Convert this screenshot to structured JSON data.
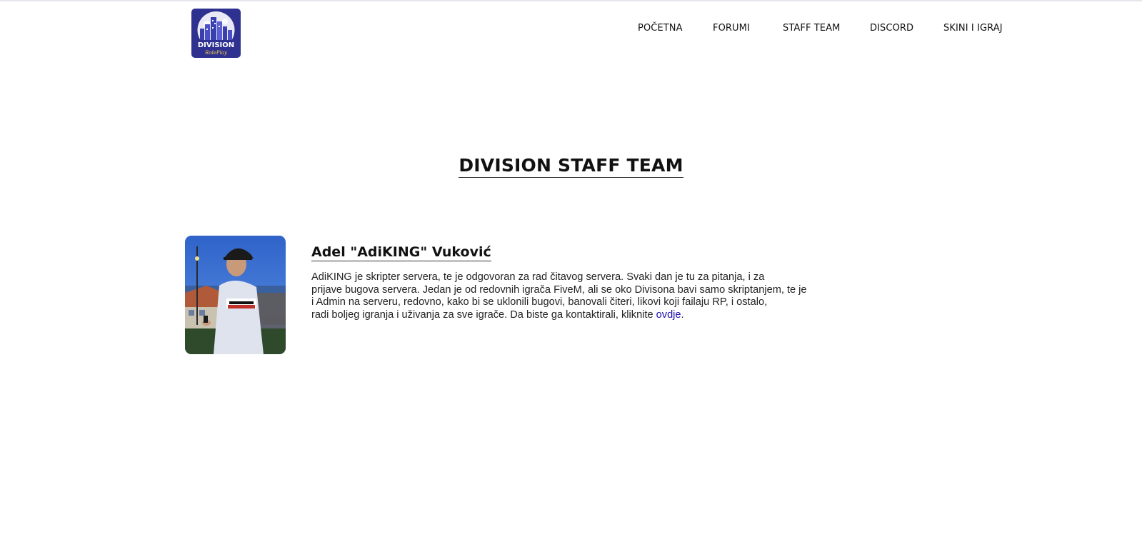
{
  "nav": {
    "logo_text": "DIVISION",
    "logo_subtext": "RolePlay",
    "links": [
      {
        "label": "POČETNA"
      },
      {
        "label": "FORUMI"
      },
      {
        "label": "STAFF TEAM"
      },
      {
        "label": "DISCORD"
      },
      {
        "label": "SKINI I IGRAJ"
      }
    ]
  },
  "page": {
    "title": "DIVISION STAFF TEAM"
  },
  "members": [
    {
      "name": "Adel \"AdiKING\" Vuković",
      "bio_lines": [
        "AdiKING je skripter servera, te je odgovoran za rad čitavog servera. Svaki dan je tu za pitanja, i za",
        "prijave bugova servera. Jedan je od redovnih igrača FiveM, ali se oko Divisona bavi samo skriptanjem, te je",
        "i Admin na serveru, redovno, kako bi se uklonili bugovi, banovali čiteri, likovi koji failaju RP, i ostalo,",
        "radi boljeg igranja i uživanja za sve igrače. Da biste ga kontaktirali, kliknite "
      ],
      "link_text": "ovdje",
      "bio_end": "."
    }
  ],
  "colors": {
    "logo_bg": "#2e3190",
    "link": "#1a0dab",
    "text": "#111111"
  }
}
